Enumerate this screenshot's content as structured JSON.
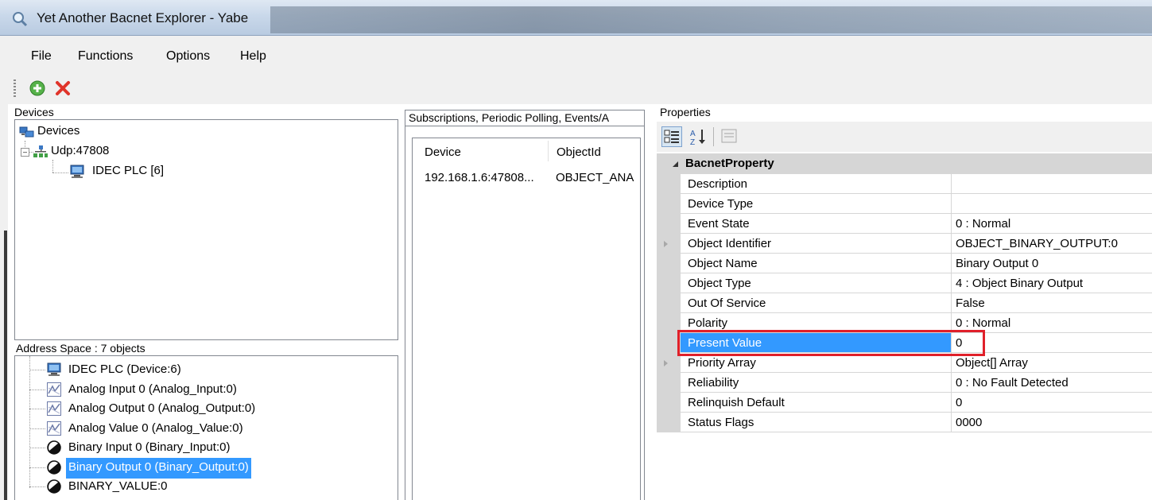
{
  "window": {
    "title": "Yet Another Bacnet Explorer - Yabe"
  },
  "menu": [
    "File",
    "Functions",
    "Options",
    "Help"
  ],
  "toolbar": {
    "add_icon": "add-icon",
    "remove_icon": "remove-icon"
  },
  "devices": {
    "label": "Devices",
    "tree": {
      "root": "Devices",
      "network": "Udp:47808",
      "device": "IDEC PLC [6]"
    }
  },
  "address_space": {
    "label": "Address Space : 7 objects",
    "items": [
      {
        "label": "IDEC PLC (Device:6)",
        "icon": "computer-icon",
        "selected": false
      },
      {
        "label": "Analog Input 0 (Analog_Input:0)",
        "icon": "analog-icon",
        "selected": false
      },
      {
        "label": "Analog Output 0 (Analog_Output:0)",
        "icon": "analog-icon",
        "selected": false
      },
      {
        "label": "Analog Value 0 (Analog_Value:0)",
        "icon": "analog-icon",
        "selected": false
      },
      {
        "label": "Binary Input 0 (Binary_Input:0)",
        "icon": "binary-icon",
        "selected": false
      },
      {
        "label": "Binary Output 0 (Binary_Output:0)",
        "icon": "binary-icon",
        "selected": true
      },
      {
        "label": "BINARY_VALUE:0",
        "icon": "binary-icon",
        "selected": false
      }
    ]
  },
  "subscriptions": {
    "tab_label": "Subscriptions, Periodic Polling, Events/A",
    "columns": [
      "Device",
      "ObjectId"
    ],
    "rows": [
      [
        "192.168.1.6:47808...",
        "OBJECT_ANA"
      ]
    ]
  },
  "properties": {
    "label": "Properties",
    "category": "BacnetProperty",
    "rows": [
      {
        "name": "Description",
        "value": "",
        "expandable": false,
        "selected": false
      },
      {
        "name": "Device Type",
        "value": "",
        "expandable": false,
        "selected": false
      },
      {
        "name": "Event State",
        "value": "0 : Normal",
        "expandable": false,
        "selected": false
      },
      {
        "name": "Object Identifier",
        "value": "OBJECT_BINARY_OUTPUT:0",
        "expandable": true,
        "selected": false
      },
      {
        "name": "Object Name",
        "value": "Binary Output 0",
        "expandable": false,
        "selected": false
      },
      {
        "name": "Object Type",
        "value": "4 : Object Binary Output",
        "expandable": false,
        "selected": false
      },
      {
        "name": "Out Of Service",
        "value": "False",
        "expandable": false,
        "selected": false
      },
      {
        "name": "Polarity",
        "value": "0 : Normal",
        "expandable": false,
        "selected": false
      },
      {
        "name": "Present Value",
        "value": "0",
        "expandable": false,
        "selected": true
      },
      {
        "name": "Priority Array",
        "value": "Object[] Array",
        "expandable": true,
        "selected": false
      },
      {
        "name": "Reliability",
        "value": "0 : No Fault Detected",
        "expandable": false,
        "selected": false
      },
      {
        "name": "Relinquish Default",
        "value": "0",
        "expandable": false,
        "selected": false
      },
      {
        "name": "Status Flags",
        "value": "0000",
        "expandable": false,
        "selected": false
      }
    ]
  },
  "colors": {
    "selection": "#3399ff",
    "highlight_box": "#e0202a",
    "grid_line": "#d6d6d6"
  }
}
